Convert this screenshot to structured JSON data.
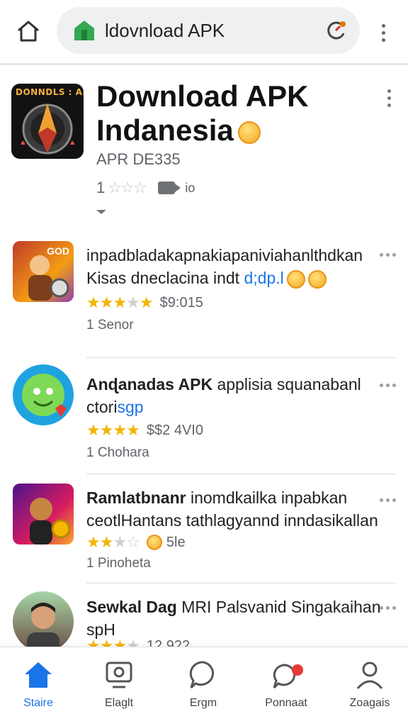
{
  "browser": {
    "url_text": "ldovnload APK"
  },
  "app": {
    "icon_label": "DONNDLS : APK",
    "title_line1": "Download APK",
    "title_line2": "Indanesia",
    "developer": "APR DE335",
    "rating_prefix": "1",
    "info_text": "io"
  },
  "list": [
    {
      "title": "inpadbladakapnakiapaniviahanlthdkan Kisas dneclacina indt",
      "title_link": "d;dp.l",
      "price": "$9:015",
      "sub": "1 Senor",
      "rating": 3.5,
      "thumb_label": "GOD"
    },
    {
      "title_bold": "Anɖanadas APK",
      "title": " applisia squanabanl ctori",
      "title_link": "sgp",
      "price": "$$2 4VI0",
      "sub": "1 Chohara",
      "rating": 4
    },
    {
      "title_bold": "Ramlatbnanr",
      "title": " inomdkailka inpabkan ceotlHantans tathlagyannd inndasikallan",
      "price": "5le",
      "sub": "1 Pinoheta",
      "rating": 2.5
    },
    {
      "title_bold": "Sewkal Dag",
      "title": " MRI Palsvanid Singakaihan spH",
      "price": "12.922",
      "rating": 3
    }
  ],
  "nav": [
    {
      "label": "Staire",
      "icon": "home-icon",
      "active": true
    },
    {
      "label": "Elaglt",
      "icon": "monitor-icon"
    },
    {
      "label": "Ergm",
      "icon": "chat-bubble-icon"
    },
    {
      "label": "Ponnaat",
      "icon": "notification-chat-icon"
    },
    {
      "label": "Zoagais",
      "icon": "profile-icon"
    }
  ],
  "colors": {
    "accent": "#1a73e8",
    "star": "#f4b400",
    "shield": "#34a853",
    "badge": "#e53935"
  }
}
